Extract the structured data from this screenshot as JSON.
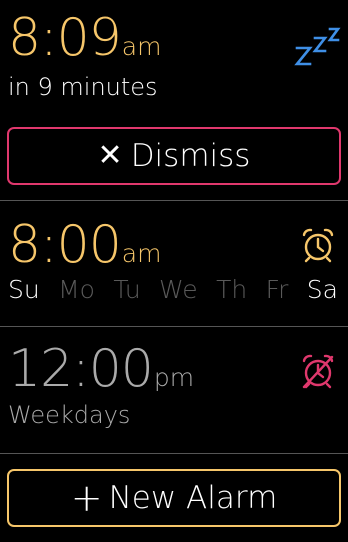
{
  "snoozed_alarm": {
    "time": "8:09",
    "period": "am",
    "countdown": "in 9 minutes",
    "time_color": "#f6c66a",
    "snooze_icon": "snooze-zzz-icon",
    "snooze_icon_color": "#3f8fe6"
  },
  "dismiss_button": {
    "icon": "close-icon",
    "icon_glyph": "✕",
    "label": "Dismiss",
    "border_color": "#e0386d"
  },
  "alarms": [
    {
      "time": "8:00",
      "period": "am",
      "enabled": true,
      "time_color": "#f6c66a",
      "icon": "alarm-clock-on-icon",
      "icon_color": "#f6c66a",
      "days": [
        {
          "label": "Su",
          "active": true
        },
        {
          "label": "Mo",
          "active": false
        },
        {
          "label": "Tu",
          "active": false
        },
        {
          "label": "We",
          "active": false
        },
        {
          "label": "Th",
          "active": false
        },
        {
          "label": "Fr",
          "active": false
        },
        {
          "label": "Sa",
          "active": true
        }
      ]
    },
    {
      "time": "12:00",
      "period": "pm",
      "enabled": false,
      "time_color": "#aaaaaa",
      "repeat": "Weekdays",
      "icon": "alarm-clock-off-icon",
      "icon_color": "#e0386d"
    }
  ],
  "new_alarm_button": {
    "icon": "plus-icon",
    "icon_glyph": "+",
    "label": "New Alarm",
    "border_color": "#f6c66a"
  }
}
